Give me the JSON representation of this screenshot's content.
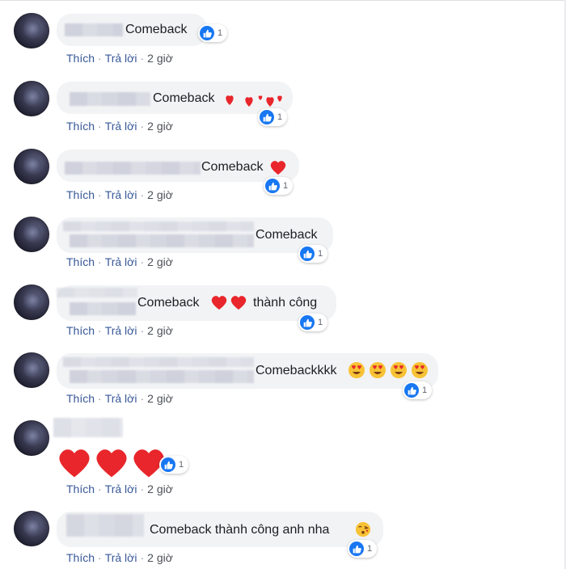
{
  "actions": {
    "like": "Thích",
    "reply": "Trả lời",
    "time": "2 giờ",
    "sep": "·"
  },
  "colors": {
    "like_blue": "#1877f2",
    "link": "#385898",
    "bubble": "#f2f3f5",
    "heart": "#e8262b"
  },
  "comments": [
    {
      "text": "Comeback",
      "likes": "1",
      "decoration": "none"
    },
    {
      "text": "Comeback",
      "likes": "1",
      "decoration": "three-small-hearts"
    },
    {
      "text": "Comeback",
      "likes": "1",
      "decoration": "heart"
    },
    {
      "text": "Comeback",
      "likes": "1",
      "decoration": "none"
    },
    {
      "text_before": "Comeback",
      "text_after": "thành công",
      "likes": "1",
      "decoration": "two-hearts"
    },
    {
      "text": "Comebackkkk",
      "likes": "1",
      "decoration": "four-heart-eyes-emoji"
    },
    {
      "text": "",
      "likes": "1",
      "decoration": "three-big-hearts"
    },
    {
      "text": "Comeback thành công anh nha",
      "likes": "1",
      "decoration": "kiss-emoji"
    }
  ]
}
